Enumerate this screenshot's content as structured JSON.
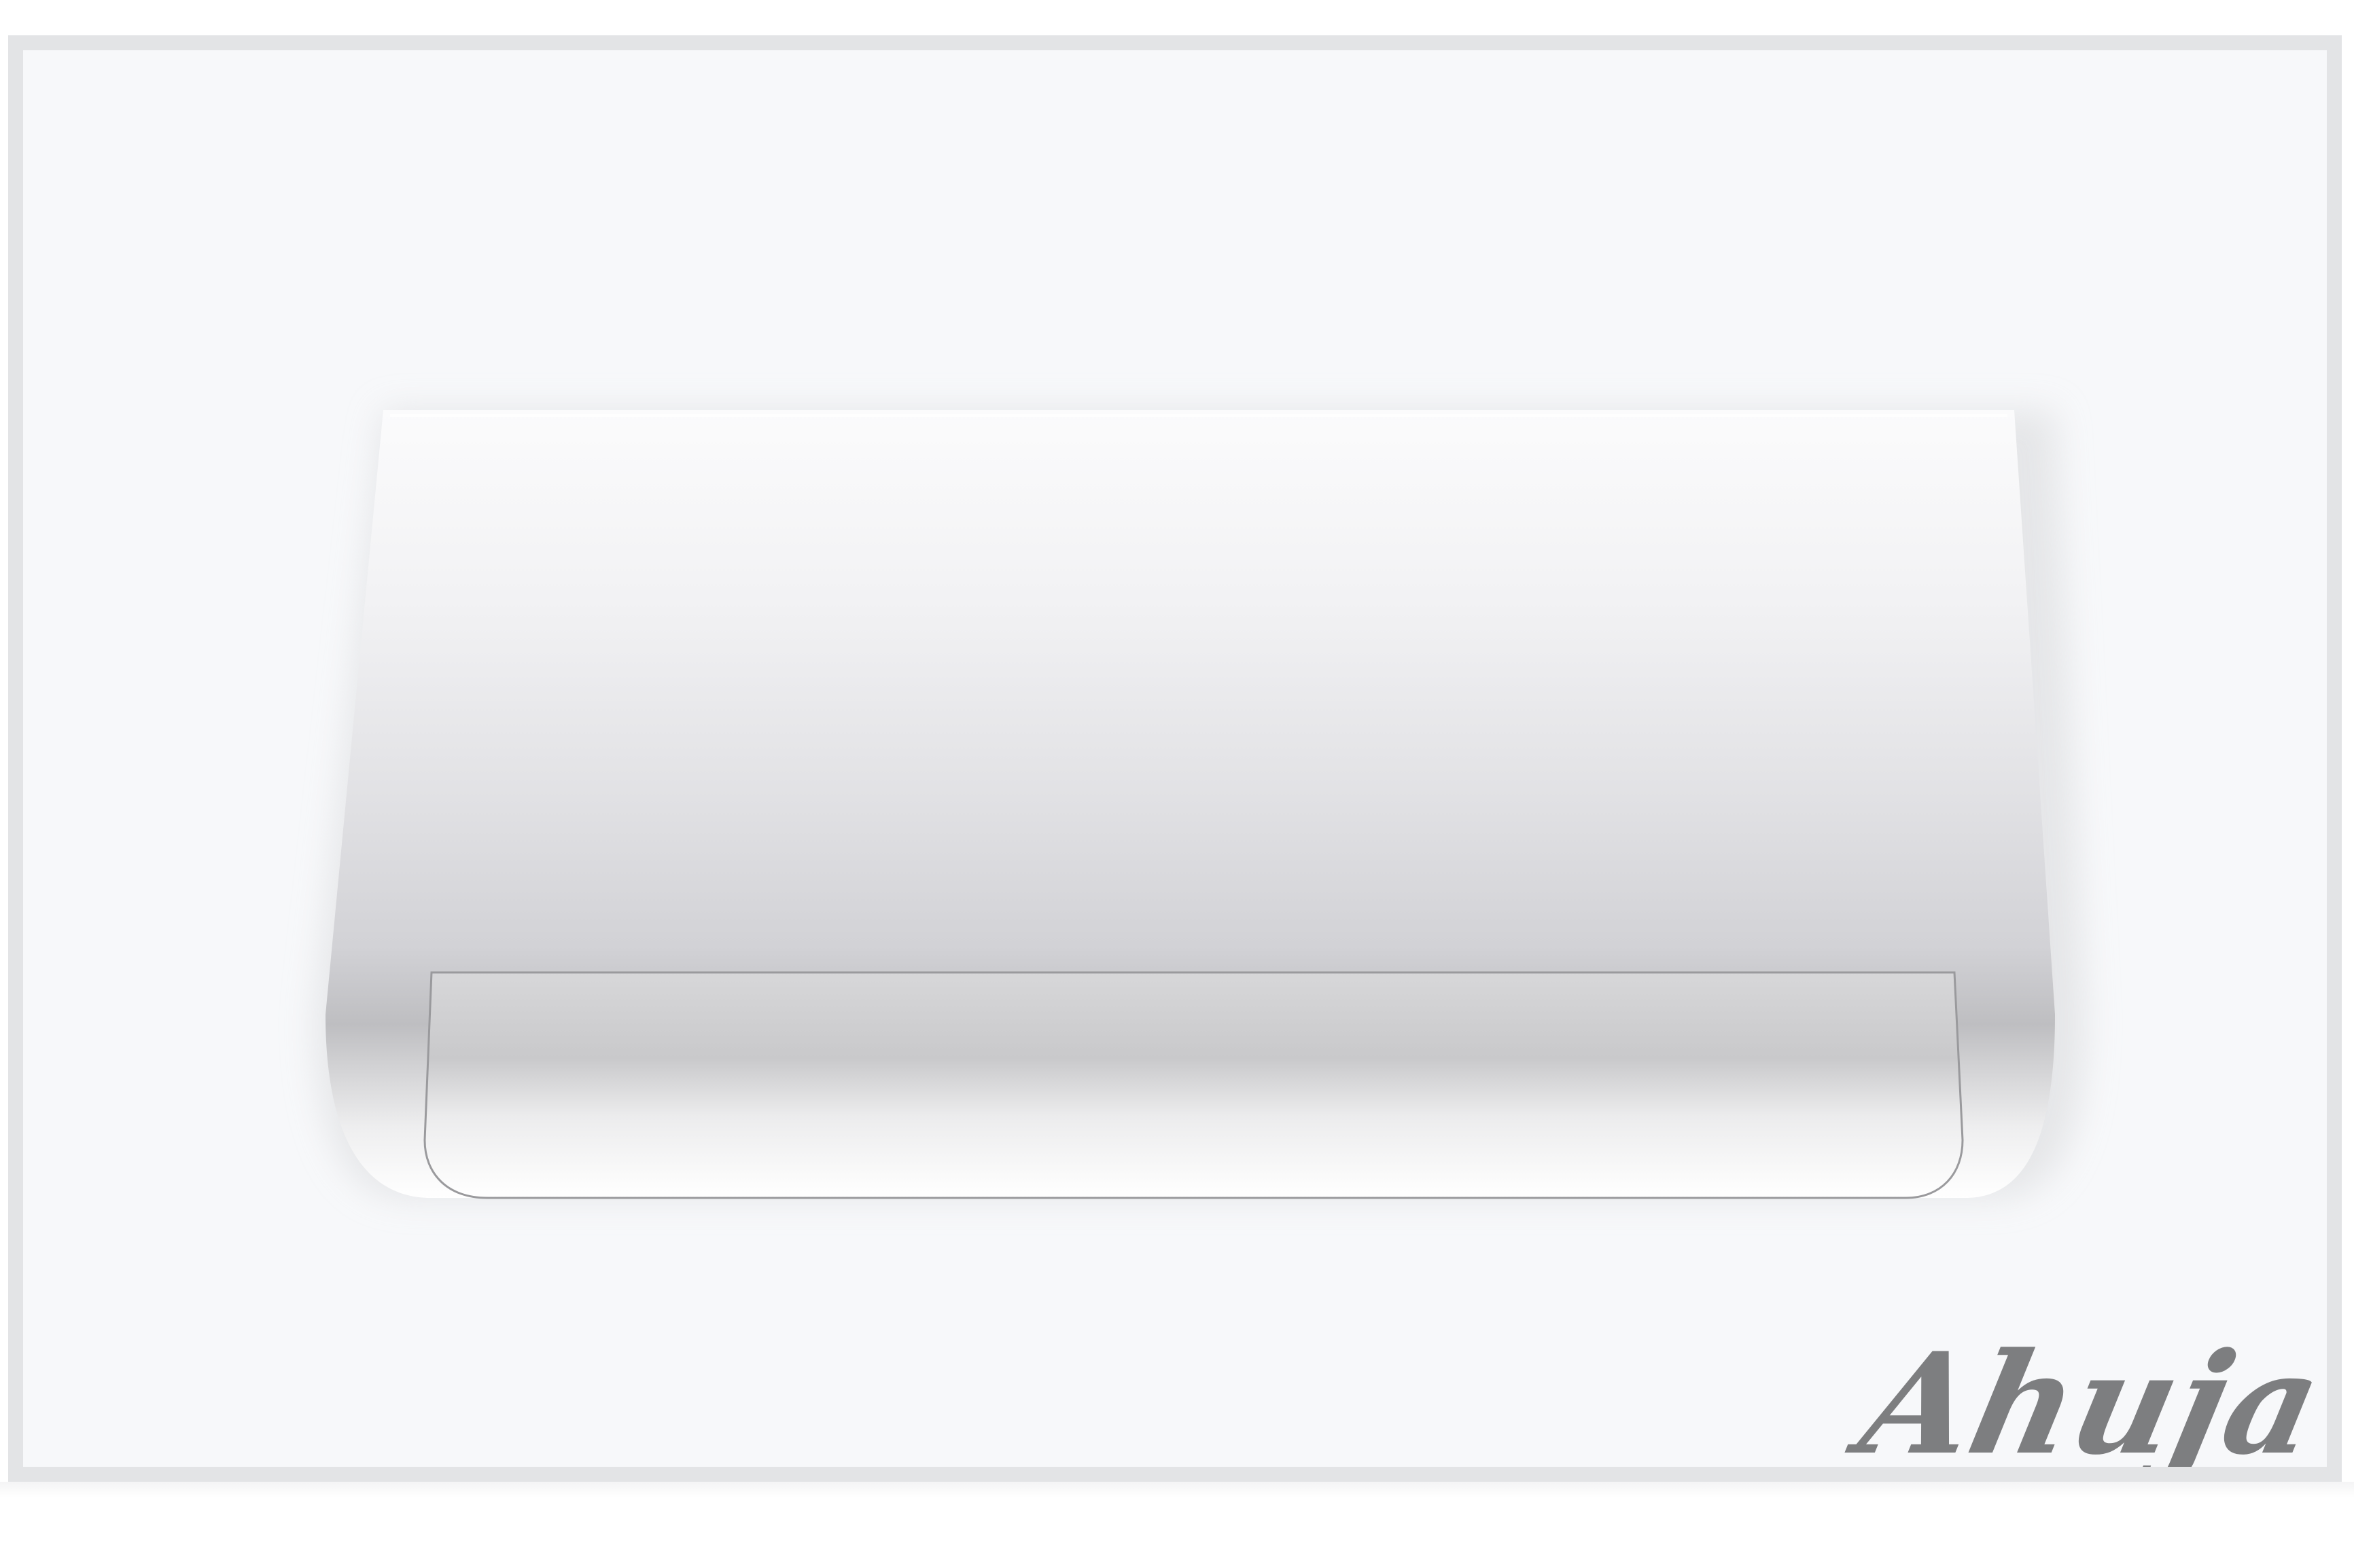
{
  "brand": {
    "name": "Ahuja"
  },
  "colors": {
    "background": "#ffffff",
    "panel": "#f7f8fa",
    "panel_border": "#e3e4e6",
    "button_light": "#fbfbfc",
    "button_mid": "#d0d0d4",
    "button_dark": "#bcbcbf",
    "logo": "#7d7e80"
  },
  "icons": {
    "flush_button": "flush-button-icon",
    "brand_logo": "brand-logo-icon"
  }
}
